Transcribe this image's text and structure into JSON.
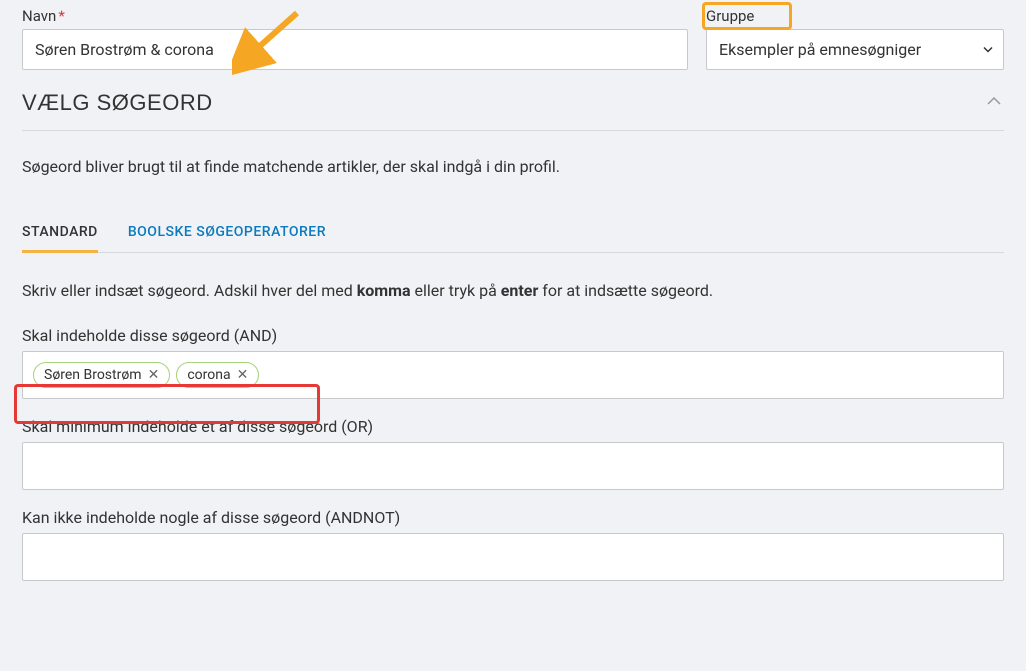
{
  "top": {
    "navn_label": "Navn",
    "navn_value": "Søren Brostrøm & corona",
    "gruppe_label": "Gruppe",
    "gruppe_value": "Eksempler på emnesøgniger"
  },
  "section": {
    "title": "VÆLG SØGEORD",
    "description": "Søgeord bliver brugt til at finde matchende artikler, der skal indgå i din profil."
  },
  "tabs": {
    "standard": "STANDARD",
    "boolean": "BOOLSKE SØGEOPERATORER"
  },
  "instruction_parts": {
    "p1": "Skriv eller indsæt søgeord. Adskil hver del med ",
    "b1": "komma",
    "p2": " eller tryk på ",
    "b2": "enter",
    "p3": " for at indsætte søgeord."
  },
  "fields": {
    "and_label": "Skal indeholde disse søgeord (AND)",
    "and_tags": [
      "Søren Brostrøm",
      "corona"
    ],
    "or_label": "Skal minimum indeholde et af disse søgeord (OR)",
    "andnot_label": "Kan ikke indeholde nogle af disse søgeord (ANDNOT)"
  }
}
